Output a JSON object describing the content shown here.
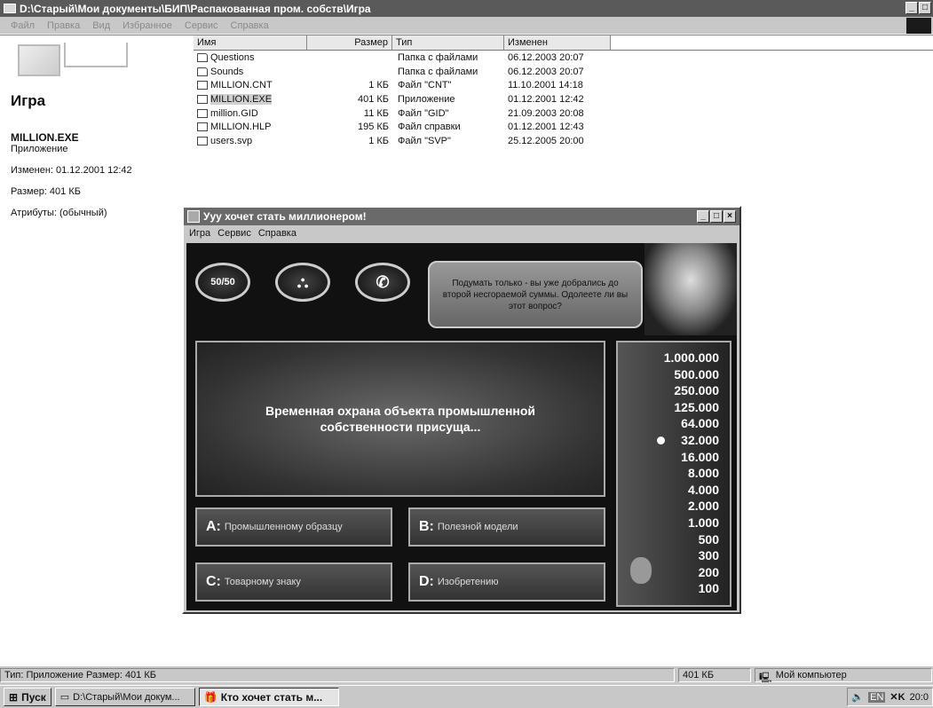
{
  "explorer": {
    "title": "D:\\Старый\\Мои документы\\БИП\\Распакованная пром. собств\\Игра",
    "menu": [
      "Файл",
      "Правка",
      "Вид",
      "Избранное",
      "Сервис",
      "Справка"
    ],
    "left_pane": {
      "folder_title": "Игра",
      "file_name": "MILLION.EXE",
      "file_type": "Приложение",
      "modified": "Изменен: 01.12.2001 12:42",
      "size": "Размер: 401 КБ",
      "attributes": "Атрибуты: (обычный)"
    },
    "columns": [
      "Имя",
      "Размер",
      "Тип",
      "Изменен"
    ],
    "rows": [
      {
        "name": "Questions",
        "size": "",
        "type": "Папка с файлами",
        "modified": "06.12.2003 20:07",
        "icon": "folder-icon"
      },
      {
        "name": "Sounds",
        "size": "",
        "type": "Папка с файлами",
        "modified": "06.12.2003 20:07",
        "icon": "folder-icon"
      },
      {
        "name": "MILLION.CNT",
        "size": "1 КБ",
        "type": "Файл \"CNT\"",
        "modified": "11.10.2001 14:18",
        "icon": "file-icon"
      },
      {
        "name": "MILLION.EXE",
        "size": "401 КБ",
        "type": "Приложение",
        "modified": "01.12.2001 12:42",
        "icon": "app-icon"
      },
      {
        "name": "million.GID",
        "size": "11 КБ",
        "type": "Файл \"GID\"",
        "modified": "21.09.2003 20:08",
        "icon": "file-icon"
      },
      {
        "name": "MILLION.HLP",
        "size": "195 КБ",
        "type": "Файл справки",
        "modified": "01.12.2001 12:43",
        "icon": "help-icon"
      },
      {
        "name": "users.svp",
        "size": "1 КБ",
        "type": "Файл \"SVP\"",
        "modified": "25.12.2005 20:00",
        "icon": "file-icon"
      }
    ],
    "status": {
      "text": "Тип: Приложение Размер: 401 КБ",
      "size": "401 КБ",
      "location": "Мой компьютер"
    }
  },
  "game": {
    "title": "Ууу хочет стать миллионером!",
    "menu": [
      "Игра",
      "Сервис",
      "Справка"
    ],
    "lifelines": {
      "fifty_label": "50/50"
    },
    "host_message": "Подумать только - вы уже добрались до второй несгораемой суммы. Одолеете ли вы этот вопрос?",
    "question": "Временная охрана объекта промышленной собственности присуща...",
    "answers": [
      {
        "letter": "A:",
        "text": "Промышленному образцу"
      },
      {
        "letter": "B:",
        "text": "Полезной модели"
      },
      {
        "letter": "C:",
        "text": "Товарному знаку"
      },
      {
        "letter": "D:",
        "text": "Изобретению"
      }
    ],
    "money_ladder": [
      "1.000.000",
      "500.000",
      "250.000",
      "125.000",
      "64.000",
      "32.000",
      "16.000",
      "8.000",
      "4.000",
      "2.000",
      "1.000",
      "500",
      "300",
      "200",
      "100"
    ],
    "current_level": "32.000"
  },
  "taskbar": {
    "start": "Пуск",
    "tasks": [
      "D:\\Старый\\Мои докум...",
      "Кто хочет стать м..."
    ],
    "tray_lang": "EN",
    "clock": "20:0"
  }
}
